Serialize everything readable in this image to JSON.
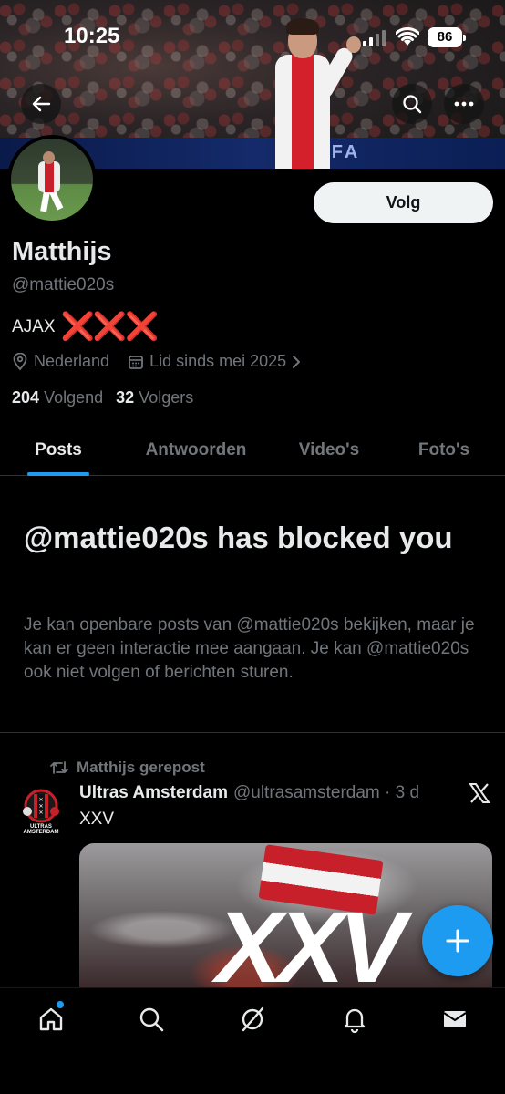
{
  "status_bar": {
    "time": "10:25",
    "battery": "86"
  },
  "profile": {
    "follow_label": "Volg",
    "name": "Matthijs",
    "handle": "@mattie020s",
    "bio": "AJAX",
    "bio_emoji": "❌❌❌",
    "location": "Nederland",
    "joined": "Lid sinds mei 2025",
    "following_count": "204",
    "following_label": "Volgend",
    "followers_count": "32",
    "followers_label": "Volgers"
  },
  "tabs": [
    {
      "label": "Posts",
      "active": true
    },
    {
      "label": "Antwoorden",
      "active": false
    },
    {
      "label": "Video's",
      "active": false
    },
    {
      "label": "Foto's",
      "active": false
    }
  ],
  "blocked": {
    "title": "@mattie020s has blocked you",
    "message": "Je kan openbare posts van @mattie020s bekijken, maar je kan er geen interactie mee aangaan. Je kan @mattie020s ook niet volgen of berichten sturen."
  },
  "post": {
    "repost_label": "Matthijs gerepost",
    "author": "Ultras Amsterdam",
    "handle_time": "@ultrasamsterdam · 3 d",
    "text": "XXV",
    "avatar_text": "ULTRAS AMSTERDAM",
    "media_text": "XXV"
  },
  "banner": {
    "board_text": "UEFA"
  },
  "colors": {
    "accent": "#1d9bf0",
    "background": "#000000",
    "muted": "#71767b",
    "text": "#e7e9ea",
    "ajax_red": "#c8202a"
  },
  "icons": [
    "back-arrow-icon",
    "search-icon",
    "more-icon",
    "location-icon",
    "calendar-icon",
    "chevron-right-icon",
    "repost-icon",
    "x-logo-icon",
    "compose-plus-icon",
    "home-icon",
    "explore-icon",
    "grok-icon",
    "notifications-icon",
    "messages-icon"
  ]
}
